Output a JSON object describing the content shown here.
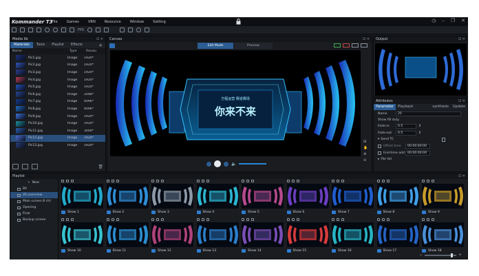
{
  "app": {
    "title": "Kommander T3"
  },
  "menu": [
    "File",
    "Games",
    "VRN",
    "Resource",
    "Window",
    "Setting"
  ],
  "toolbar": {
    "fps_label": "FPS"
  },
  "media_lib": {
    "title": "Media lib",
    "tabs": [
      "Materials",
      "Tools",
      "Playlist",
      "Effects"
    ],
    "columns": [
      "Name",
      "Type",
      "Resolu"
    ],
    "items": [
      {
        "name": "Pic1.jpg",
        "type": "Image",
        "size": "1920*1",
        "color": "#1a2f7a"
      },
      {
        "name": "Pic2.jpg",
        "type": "Image",
        "size": "1920*1",
        "color": "#3155b8"
      },
      {
        "name": "Pic3.jpg",
        "type": "Image",
        "size": "1920*1",
        "color": "#2e3d8c"
      },
      {
        "name": "Pic4.jpg",
        "type": "Image",
        "size": "1920*1",
        "color": "#b23b52"
      },
      {
        "name": "Pic5.jpg",
        "type": "Image",
        "size": "1920*1",
        "color": "#2252b8"
      },
      {
        "name": "Pic6.jpg",
        "type": "Image",
        "size": "2048*1",
        "color": "#27468e"
      },
      {
        "name": "Pic7.jpg",
        "type": "Image",
        "size": "4096*2",
        "color": "#153a8a"
      },
      {
        "name": "Pic8.jpg",
        "type": "Image",
        "size": "4096*2",
        "color": "#1f6cc2"
      },
      {
        "name": "Pic9.jpg",
        "type": "Image",
        "size": "1920*1",
        "color": "#3c6fd8"
      },
      {
        "name": "Pic10.jpg",
        "type": "Image",
        "size": "1920*1",
        "color": "#1c8f9b"
      },
      {
        "name": "Pic11.jpg",
        "type": "Image",
        "size": "3000*1",
        "color": "#2b5aa8"
      },
      {
        "name": "Pic12.jpg",
        "type": "Image",
        "size": "1920*1",
        "color": "#4a6cd0"
      },
      {
        "name": "Pic13.jpg",
        "type": "Image",
        "size": "1920*1",
        "color": "#2a3f7a"
      }
    ],
    "selected_index": 11
  },
  "canvas": {
    "title": "Canvas",
    "tabs": [
      "Edit Mode",
      "Preview"
    ],
    "screen_title": "你来不来",
    "screen_subtitle": "方程运营  赛道赛场"
  },
  "output": {
    "title": "Output"
  },
  "attributes": {
    "title": "Attributes",
    "tabs": [
      "Parameter",
      "Playback progress",
      "synthesis",
      "Update"
    ],
    "name_label": "Name",
    "name_value": "25",
    "section_label": "Show fill duty",
    "rows": [
      {
        "label": "Fade-in",
        "value": "0.5"
      },
      {
        "label": "Fade-out",
        "value": "0.5"
      }
    ],
    "send_tc_label": "Send TC",
    "offset_label": "Offset time",
    "offset_value": "00:00:00:00",
    "endtc_label": "End-time add",
    "endtc_value": "00:00:00:00",
    "filelist_label": "File list"
  },
  "playlist": {
    "title": "Playlist",
    "new_label": "New",
    "tree": [
      "BV",
      "VS overview",
      "Main screen B ctrl",
      "Opening",
      "Final",
      "Backup screen"
    ],
    "selected_tree_index": 1,
    "shows_row1": [
      {
        "label": "Show 1",
        "color": "#24a9c9"
      },
      {
        "label": "Show 2",
        "color": "#2f8fd8"
      },
      {
        "label": "Show 3",
        "color": "#8c9aa8"
      },
      {
        "label": "Show 4",
        "color": "#2bb7d1"
      },
      {
        "label": "Show 5",
        "color": "#b54a8d"
      },
      {
        "label": "Show 6",
        "color": "#6b3fc2"
      },
      {
        "label": "Show 7",
        "color": "#1f5fcf"
      },
      {
        "label": "Show 8",
        "color": "#3fa0e8"
      },
      {
        "label": "Show 9",
        "color": "#c79a2a"
      }
    ],
    "shows_row2": [
      {
        "label": "Show 10",
        "color": "#38c2cf"
      },
      {
        "label": "Show 11",
        "color": "#2b8fd2"
      },
      {
        "label": "Show 12",
        "color": "#b0427a"
      },
      {
        "label": "Show 13",
        "color": "#2c7ec9"
      },
      {
        "label": "Show 14",
        "color": "#7a4fb6"
      },
      {
        "label": "Show 15",
        "color": "#d63b3b"
      },
      {
        "label": "Show 16",
        "color": "#26b4c4"
      },
      {
        "label": "Show 17",
        "color": "#2565c7"
      },
      {
        "label": "Show 18",
        "color": "#4a8fd8"
      }
    ]
  },
  "colors": {
    "accent": "#2c5d93",
    "bg": "#17191d",
    "screen_glow": "#2ea8ff"
  }
}
